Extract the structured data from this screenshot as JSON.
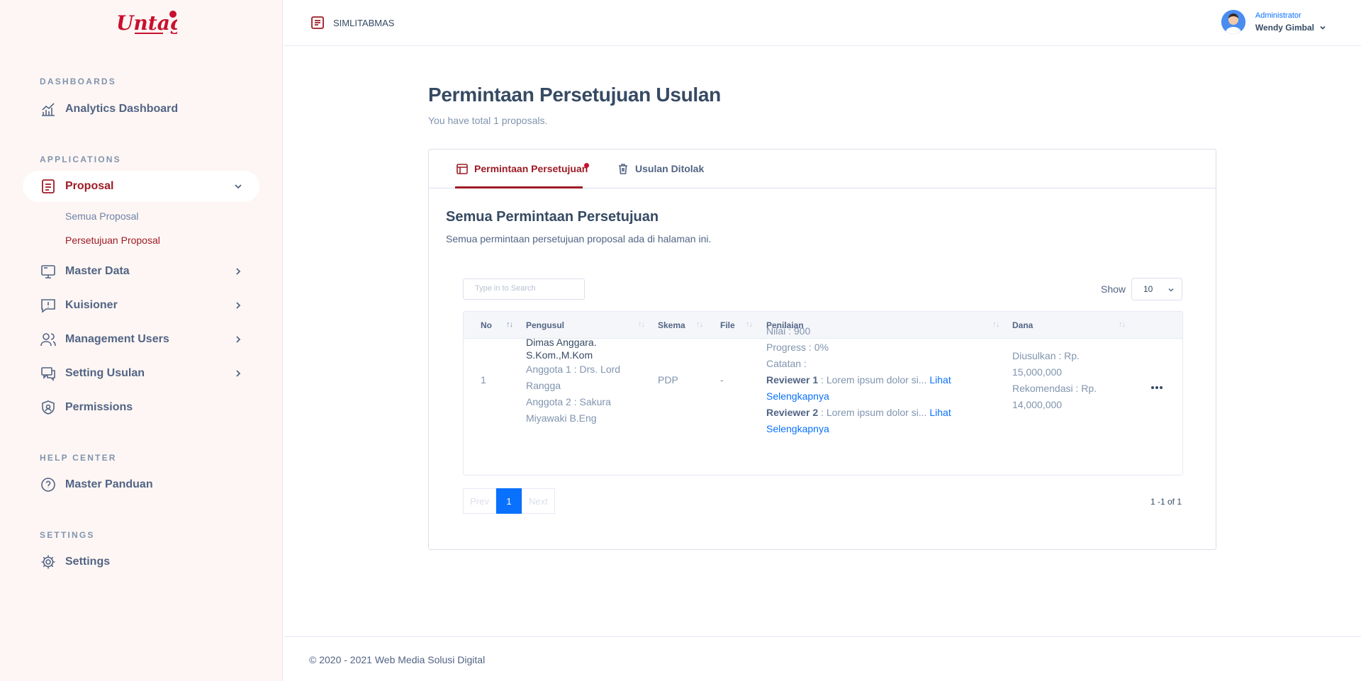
{
  "sidebar": {
    "logo_text": "Untag",
    "sections": {
      "dashboards": "DASHBOARDS",
      "applications": "APPLICATIONS",
      "help_center": "HELP CENTER",
      "settings": "SETTINGS"
    },
    "items": {
      "analytics": "Analytics Dashboard",
      "proposal": "Proposal",
      "semua_proposal": "Semua Proposal",
      "persetujuan_proposal": "Persetujuan Proposal",
      "master_data": "Master Data",
      "kuisioner": "Kuisioner",
      "management_users": "Management Users",
      "setting_usulan": "Setting Usulan",
      "permissions": "Permissions",
      "master_panduan": "Master Panduan",
      "settings": "Settings"
    }
  },
  "header": {
    "app_name": "SIMLITABMAS",
    "user_role": "Administrator",
    "user_name": "Wendy Gimbal"
  },
  "page": {
    "title": "Permintaan Persetujuan Usulan",
    "subtitle": "You have total 1 proposals."
  },
  "tabs": {
    "active": "Permintaan Persetujuan",
    "rejected": "Usulan Ditolak"
  },
  "card": {
    "title": "Semua Permintaan Persetujuan",
    "subtitle": "Semua permintaan persetujuan proposal ada di halaman ini."
  },
  "search": {
    "placeholder": "Type in to Search"
  },
  "show": {
    "label": "Show",
    "value": "10"
  },
  "table": {
    "headers": {
      "no": "No",
      "pengusul": "Pengusul",
      "skema": "Skema",
      "file": "File",
      "penilaian": "Penilaian",
      "dana": "Dana"
    },
    "row": {
      "no": "1",
      "pengusul_name_1": "Dimas Anggara.",
      "pengusul_name_2": "S.Kom.,M.Kom",
      "anggota_1a": "Anggota 1 : Drs. Lord",
      "anggota_1b": "Rangga",
      "anggota_2a": "Anggota 2 : Sakura",
      "anggota_2b": "Miyawaki B.Eng",
      "skema": "PDP",
      "file": "-",
      "nilai": "Nilai : 900",
      "progress": "Progress : 0%",
      "catatan": "Catatan :",
      "reviewer1_label": "Reviewer 1",
      "reviewer1_text": " : Lorem ipsum dolor si... ",
      "reviewer2_label": "Reviewer 2",
      "reviewer2_text": " : Lorem ipsum dolor si... ",
      "link_lihat": "Lihat",
      "link_selengkapnya": "Selengkapnya",
      "diusulkan_a": "Diusulkan : Rp.",
      "diusulkan_b": "15,000,000",
      "rekomendasi_a": "Rekomendasi : Rp.",
      "rekomendasi_b": "14,000,000"
    }
  },
  "pagination": {
    "prev": "Prev",
    "current": "1",
    "next": "Next",
    "count": "1 -1 of 1"
  },
  "footer": {
    "text": "© 2020 - 2021 Web Media Solusi Digital"
  },
  "colors": {
    "accent": "#9d1b25",
    "link": "#0971fe",
    "sidebar_bg": "#fdf6f4"
  }
}
